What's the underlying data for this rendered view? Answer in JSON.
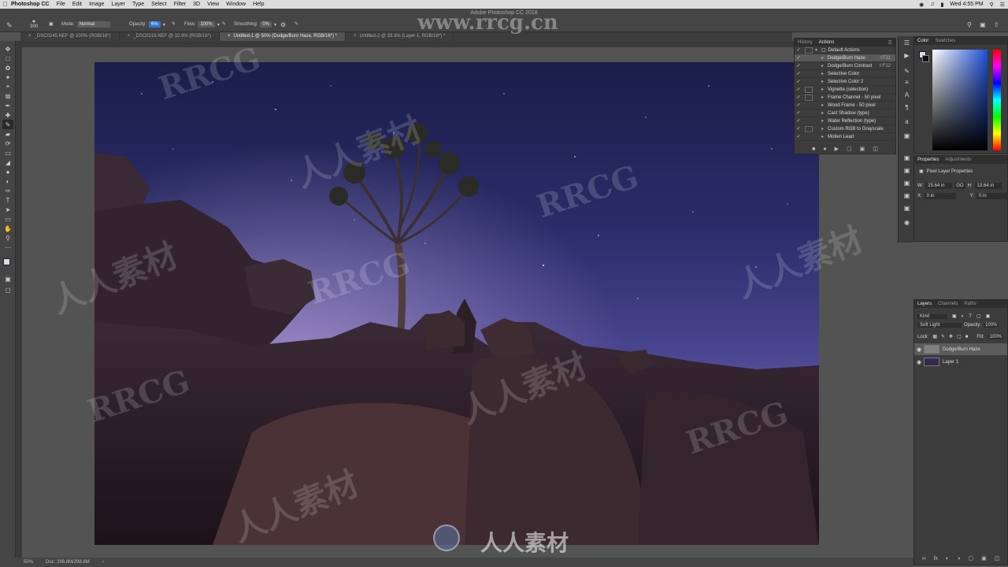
{
  "menubar": {
    "app_name": "Photoshop CC",
    "items": [
      "File",
      "Edit",
      "Image",
      "Layer",
      "Type",
      "Select",
      "Filter",
      "3D",
      "View",
      "Window",
      "Help"
    ],
    "clock": "Wed 4:55 PM"
  },
  "window_title": "Adobe Photoshop CC 2018",
  "options": {
    "brush_size": "300",
    "mode_label": "Mode:",
    "mode_value": "Normal",
    "opacity_label": "Opacity:",
    "opacity_value": "6%",
    "flow_label": "Flow:",
    "flow_value": "100%",
    "smoothing_label": "Smoothing:",
    "smoothing_value": "0%"
  },
  "tabs": [
    {
      "label": "_DSC0245.NEF @ 100% (RGB/16*)",
      "active": false
    },
    {
      "label": "_DSC0219.NEF @ 32.9% (RGB/16*)",
      "active": false
    },
    {
      "label": "Untitled-1 @ 50% (Dodge/Burn Haze, RGB/16*) *",
      "active": true
    },
    {
      "label": "Untitled-2 @ 33.3% (Layer 1, RGB/16*) *",
      "active": false
    }
  ],
  "actions_panel": {
    "tabs": [
      "History",
      "Actions"
    ],
    "active_tab": "Actions",
    "set_name": "Default Actions",
    "items": [
      {
        "label": "Dodge/Burn Haze",
        "shortcut": "⇧F11",
        "has_dialog": false,
        "selected": true
      },
      {
        "label": "Dodge/Burn Contrast",
        "shortcut": "⇧F12",
        "has_dialog": false,
        "selected": false
      },
      {
        "label": "Selective Color",
        "shortcut": "",
        "has_dialog": false,
        "selected": false
      },
      {
        "label": "Selective Color 2",
        "shortcut": "",
        "has_dialog": false,
        "selected": false
      },
      {
        "label": "Vignette (selection)",
        "shortcut": "",
        "has_dialog": true,
        "selected": false
      },
      {
        "label": "Frame Channel - 50 pixel",
        "shortcut": "",
        "has_dialog": true,
        "selected": false
      },
      {
        "label": "Wood Frame - 50 pixel",
        "shortcut": "",
        "has_dialog": false,
        "selected": false
      },
      {
        "label": "Cast Shadow (type)",
        "shortcut": "",
        "has_dialog": false,
        "selected": false
      },
      {
        "label": "Water Reflection (type)",
        "shortcut": "",
        "has_dialog": false,
        "selected": false
      },
      {
        "label": "Custom RGB to Grayscale",
        "shortcut": "",
        "has_dialog": true,
        "selected": false
      },
      {
        "label": "Molten Lead",
        "shortcut": "",
        "has_dialog": false,
        "selected": false
      }
    ]
  },
  "color_panel": {
    "tabs": [
      "Color",
      "Swatches"
    ],
    "active_tab": "Color",
    "hue_color": "#1f4fd6"
  },
  "properties_panel": {
    "tabs": [
      "Properties",
      "Adjustments"
    ],
    "active_tab": "Properties",
    "title": "Pixel Layer Properties",
    "w_label": "W:",
    "w_value": "25.64 in",
    "go_label": "GO",
    "h_label": "H:",
    "h_value": "13.64 in",
    "x_label": "X:",
    "x_value": "0 in",
    "y_label": "Y:",
    "y_value": "0 in"
  },
  "layers_panel": {
    "tabs": [
      "Layers",
      "Channels",
      "Paths"
    ],
    "active_tab": "Layers",
    "filter_kind": "Kind",
    "blend_mode": "Soft Light",
    "opacity_label": "Opacity:",
    "opacity_value": "100%",
    "lock_label": "Lock:",
    "fill_label": "Fill:",
    "fill_value": "100%",
    "layers": [
      {
        "name": "Dodge/Burn Haze",
        "selected": true
      },
      {
        "name": "Layer 1",
        "selected": false
      }
    ]
  },
  "status": {
    "zoom": "50%",
    "doc": "Doc: 298.8M/298.8M"
  },
  "watermarks": {
    "brand_text": "www.rrcg.cn",
    "logo_text": "RRCG",
    "cn_text": "人人素材"
  },
  "colors": {
    "accent": "#2c77d0",
    "ui_dark": "#3c3c3c",
    "ui_mid": "#535353"
  }
}
